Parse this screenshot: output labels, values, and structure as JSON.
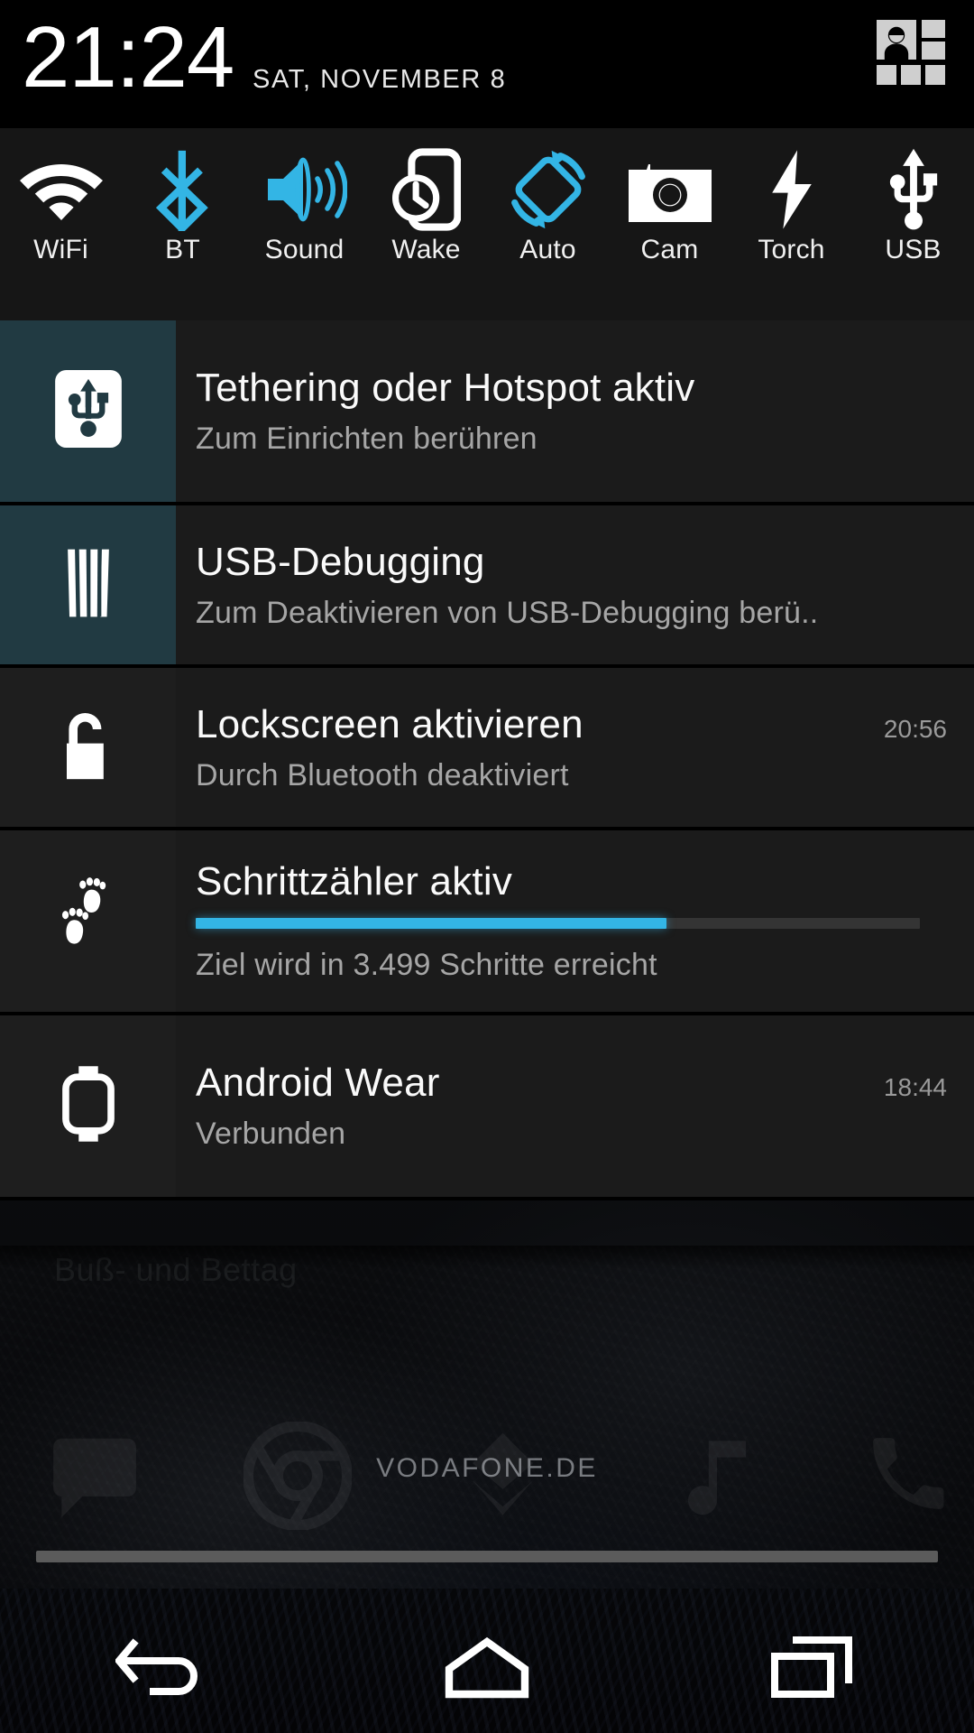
{
  "status_header": {
    "clock": "21:24",
    "date": "SAT, NOVEMBER 8",
    "multiuser_icon": "multi-user-grid-icon"
  },
  "quick_settings": {
    "tiles": [
      {
        "label": "WiFi",
        "icon": "wifi-icon",
        "active": false,
        "color": "#ffffff"
      },
      {
        "label": "BT",
        "icon": "bluetooth-icon",
        "active": true,
        "color": "#33b5e5"
      },
      {
        "label": "Sound",
        "icon": "speaker-icon",
        "active": true,
        "color": "#33b5e5"
      },
      {
        "label": "Wake",
        "icon": "phone-clock-icon",
        "active": false,
        "color": "#ffffff"
      },
      {
        "label": "Auto",
        "icon": "auto-rotate-icon",
        "active": true,
        "color": "#33b5e5"
      },
      {
        "label": "Cam",
        "icon": "camera-icon",
        "active": false,
        "color": "#ffffff"
      },
      {
        "label": "Torch",
        "icon": "flash-icon",
        "active": false,
        "color": "#ffffff"
      },
      {
        "label": "USB",
        "icon": "usb-icon",
        "active": false,
        "color": "#ffffff"
      }
    ]
  },
  "notifications": [
    {
      "icon": "usb-tethering-icon",
      "title": "Tethering oder Hotspot aktiv",
      "subtitle": "Zum Einrichten berühren",
      "time": "",
      "accent": true
    },
    {
      "icon": "usb-debugging-icon",
      "title": "USB-Debugging",
      "subtitle": "Zum Deaktivieren von USB-Debugging berü..",
      "time": "",
      "accent": true
    },
    {
      "icon": "open-padlock-icon",
      "title": "Lockscreen aktivieren",
      "subtitle": "Durch Bluetooth deaktiviert",
      "time": "20:56",
      "accent": false
    },
    {
      "icon": "footsteps-icon",
      "title": "Schrittzähler aktiv",
      "subtitle": "Ziel wird in 3.499 Schritte erreicht",
      "time": "",
      "accent": false,
      "progress_percent": 65
    },
    {
      "icon": "smartwatch-icon",
      "title": "Android Wear",
      "subtitle": "Verbunden",
      "time": "18:44",
      "accent": false
    }
  ],
  "home_screen": {
    "widget_text": "Buß- und Bettag",
    "carrier": "VODAFONE.DE",
    "dock_icons": [
      "messaging-icon",
      "chrome-icon",
      "apps-icon",
      "music-icon",
      "phone-icon"
    ]
  },
  "nav_bar": {
    "back": "back-icon",
    "home": "home-icon",
    "recents": "recents-icon"
  },
  "colors": {
    "accent": "#33b5e5",
    "notification_bg": "#1b1b1b",
    "accent_panel": "#213a42",
    "text_primary": "#fafafa",
    "text_secondary": "#a6a6a6"
  }
}
